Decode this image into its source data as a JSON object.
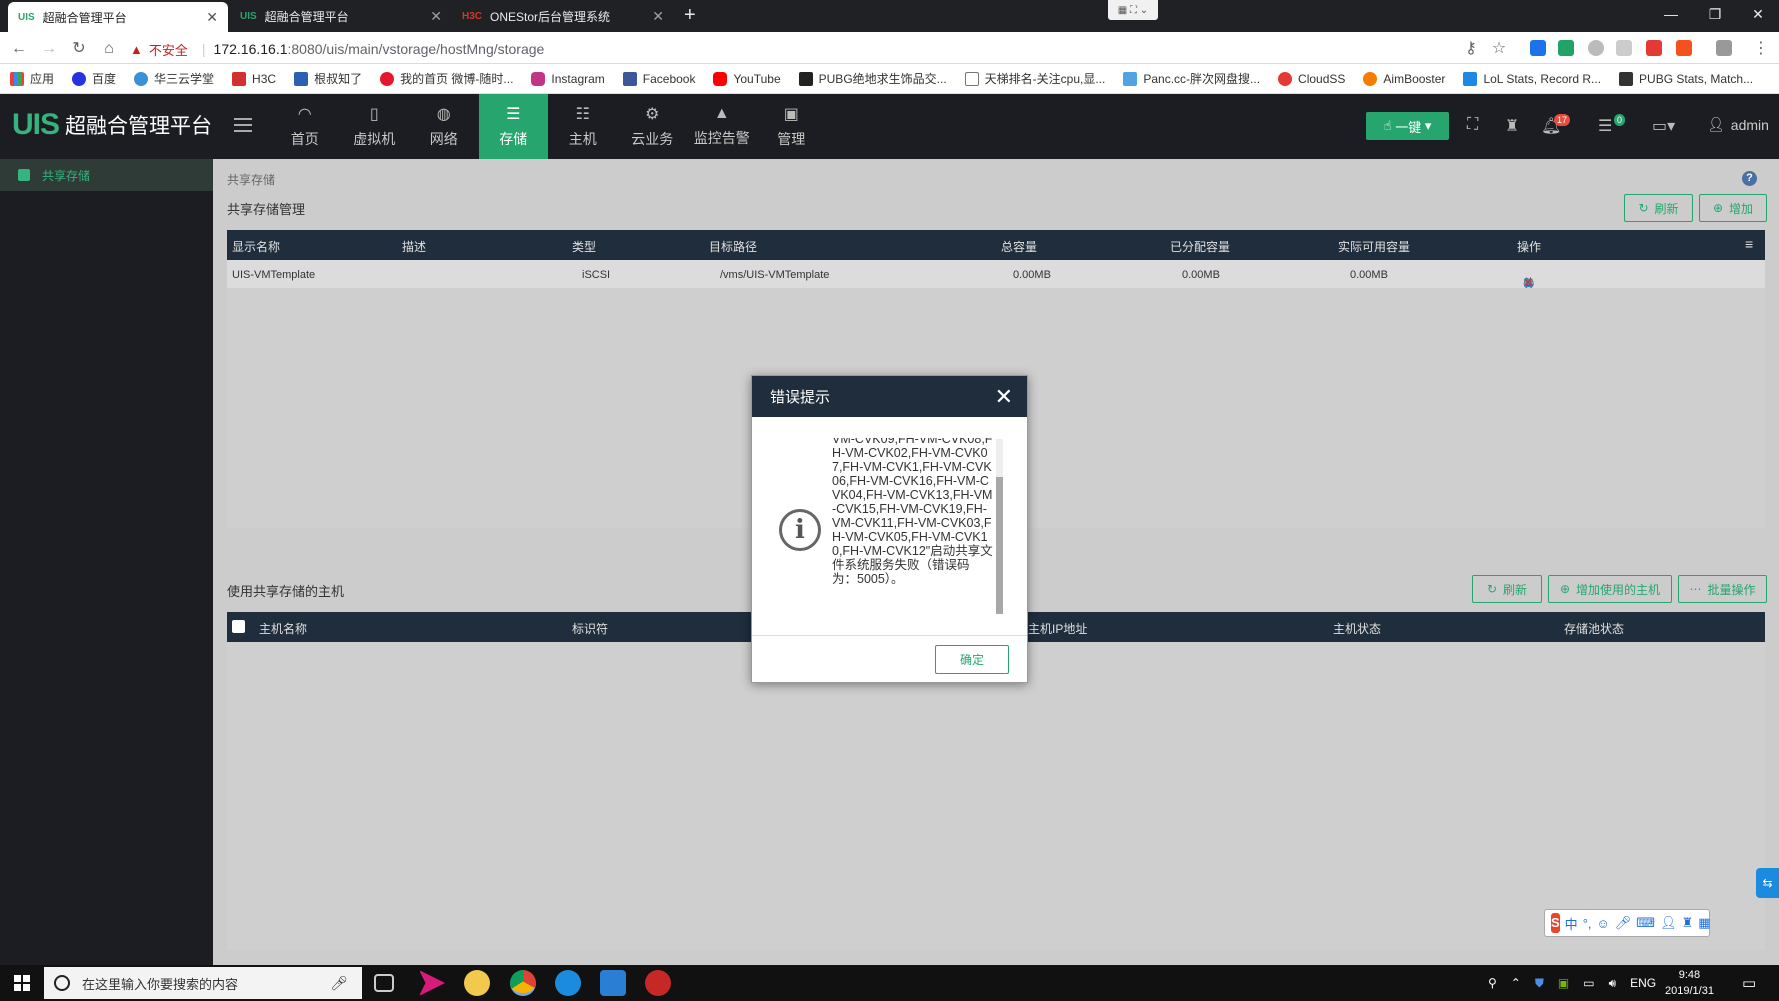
{
  "browser": {
    "tabs": [
      {
        "icon": "UIS",
        "title": "超融合管理平台",
        "active": true
      },
      {
        "icon": "UIS",
        "title": "超融合管理平台",
        "active": false
      },
      {
        "icon": "H3C",
        "title": "ONEStor后台管理系统",
        "active": false
      }
    ],
    "new_tab": "+",
    "security_warning": "不安全",
    "url_host": "172.16.16.1",
    "url_path": ":8080/uis/main/vstorage/hostMng/storage",
    "bookmarks": [
      "应用",
      "百度",
      "华三云学堂",
      "H3C",
      "根叔知了",
      "我的首页 微博-随时...",
      "Instagram",
      "Facebook",
      "YouTube",
      "PUBG绝地求生饰品交...",
      "天梯排名-关注cpu,显...",
      "Panc.cc-胖次网盘搜...",
      "CloudSS",
      "AimBooster",
      "LoL Stats, Record R...",
      "PUBG Stats, Match..."
    ]
  },
  "app": {
    "logo": "UIS",
    "title": "超融合管理平台",
    "nav": [
      {
        "label": "首页",
        "icon": "dashboard-icon"
      },
      {
        "label": "虚拟机",
        "icon": "vm-icon"
      },
      {
        "label": "网络",
        "icon": "globe-icon"
      },
      {
        "label": "存储",
        "icon": "database-icon",
        "active": true
      },
      {
        "label": "主机",
        "icon": "server-icon"
      },
      {
        "label": "云业务",
        "icon": "gear-icon"
      },
      {
        "label": "监控告警",
        "icon": "bell-icon"
      },
      {
        "label": "管理",
        "icon": "monitor-icon"
      }
    ],
    "onekey_label": "一键",
    "alarm_count": "17",
    "task_count": "0",
    "user": "admin"
  },
  "sidebar": {
    "items": [
      {
        "label": "共享存储",
        "active": true
      }
    ]
  },
  "content": {
    "breadcrumb": "共享存储",
    "section1_title": "共享存储管理",
    "refresh_label": "刷新",
    "add_label": "增加",
    "table1": {
      "headers": [
        "显示名称",
        "描述",
        "类型",
        "目标路径",
        "总容量",
        "已分配容量",
        "实际可用容量",
        "操作"
      ],
      "rows": [
        [
          "UIS-VMTemplate",
          "",
          "iSCSI",
          "/vms/UIS-VMTemplate",
          "0.00MB",
          "0.00MB",
          "0.00MB"
        ]
      ]
    },
    "section2_title": "使用共享存储的主机",
    "refresh2_label": "刷新",
    "add_host_label": "增加使用的主机",
    "batch_label": "批量操作",
    "table2": {
      "headers": [
        "主机名称",
        "标识符",
        "主机IP地址",
        "主机状态",
        "存储池状态"
      ]
    }
  },
  "dialog": {
    "title": "错误提示",
    "message": "VM-CVK09,FH-VM-CVK08,FH-VM-CVK02,FH-VM-CVK07,FH-VM-CVK1,FH-VM-CVK06,FH-VM-CVK16,FH-VM-CVK04,FH-VM-CVK13,FH-VM-CVK15,FH-VM-CVK19,FH-VM-CVK11,FH-VM-CVK03,FH-VM-CVK05,FH-VM-CVK10,FH-VM-CVK12\"启动共享文件系统服务失败（错误码为：5005）。",
    "ok_label": "确定"
  },
  "ime": {
    "logo": "S",
    "lang": "中"
  },
  "taskbar": {
    "search_placeholder": "在这里输入你要搜索的内容",
    "lang": "ENG",
    "time": "9:48",
    "date": "2019/1/31"
  },
  "colors": {
    "accent": "#26a66e",
    "header_bg": "#1b1d22",
    "table_header": "#1f2d3d"
  }
}
